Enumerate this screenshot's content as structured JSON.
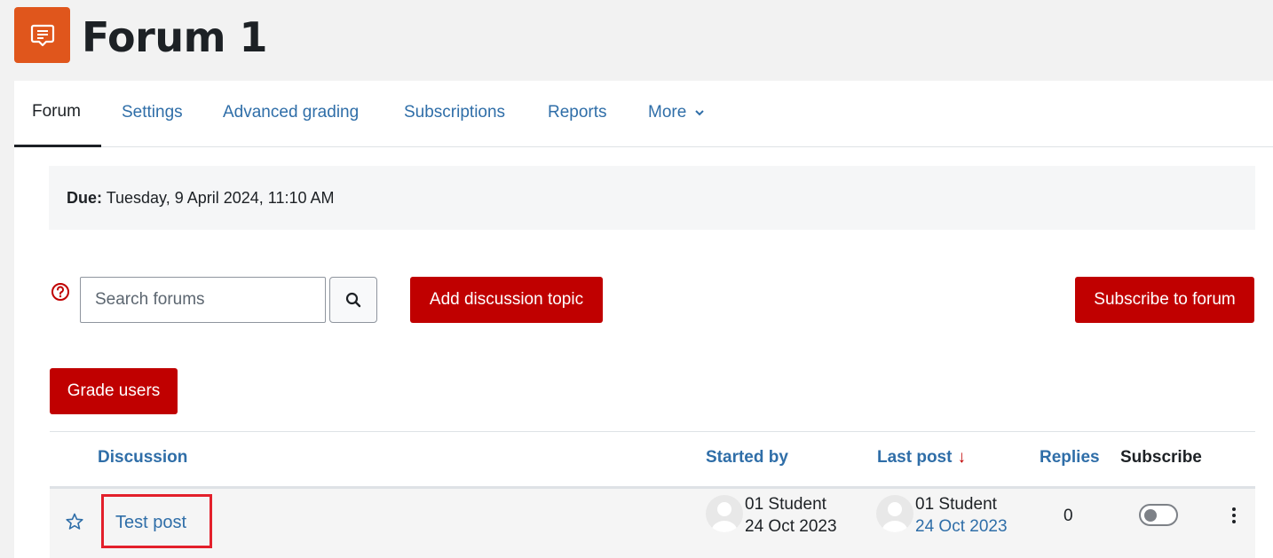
{
  "header": {
    "title": "Forum 1",
    "icon": "forum-icon",
    "icon_color": "#e0561c"
  },
  "nav": {
    "tabs": [
      {
        "label": "Forum",
        "active": true
      },
      {
        "label": "Settings",
        "active": false
      },
      {
        "label": "Advanced grading",
        "active": false
      },
      {
        "label": "Subscriptions",
        "active": false
      },
      {
        "label": "Reports",
        "active": false
      },
      {
        "label": "More",
        "active": false
      }
    ]
  },
  "due": {
    "label": "Due:",
    "value": "Tuesday, 9 April 2024, 11:10 AM"
  },
  "search": {
    "placeholder": "Search forums"
  },
  "buttons": {
    "add_discussion": "Add discussion topic",
    "subscribe": "Subscribe to forum",
    "grade_users": "Grade users",
    "accent": "#c00000"
  },
  "table": {
    "headers": {
      "discussion": "Discussion",
      "started_by": "Started by",
      "last_post": "Last post",
      "replies": "Replies",
      "subscribe": "Subscribe"
    },
    "sort_indicator": "↓",
    "rows": [
      {
        "title": "Test post",
        "started_by_name": "01 Student",
        "started_by_date": "24 Oct 2023",
        "last_post_name": "01 Student",
        "last_post_date": "24 Oct 2023",
        "replies": "0",
        "subscribed": false,
        "starred": false
      }
    ]
  }
}
